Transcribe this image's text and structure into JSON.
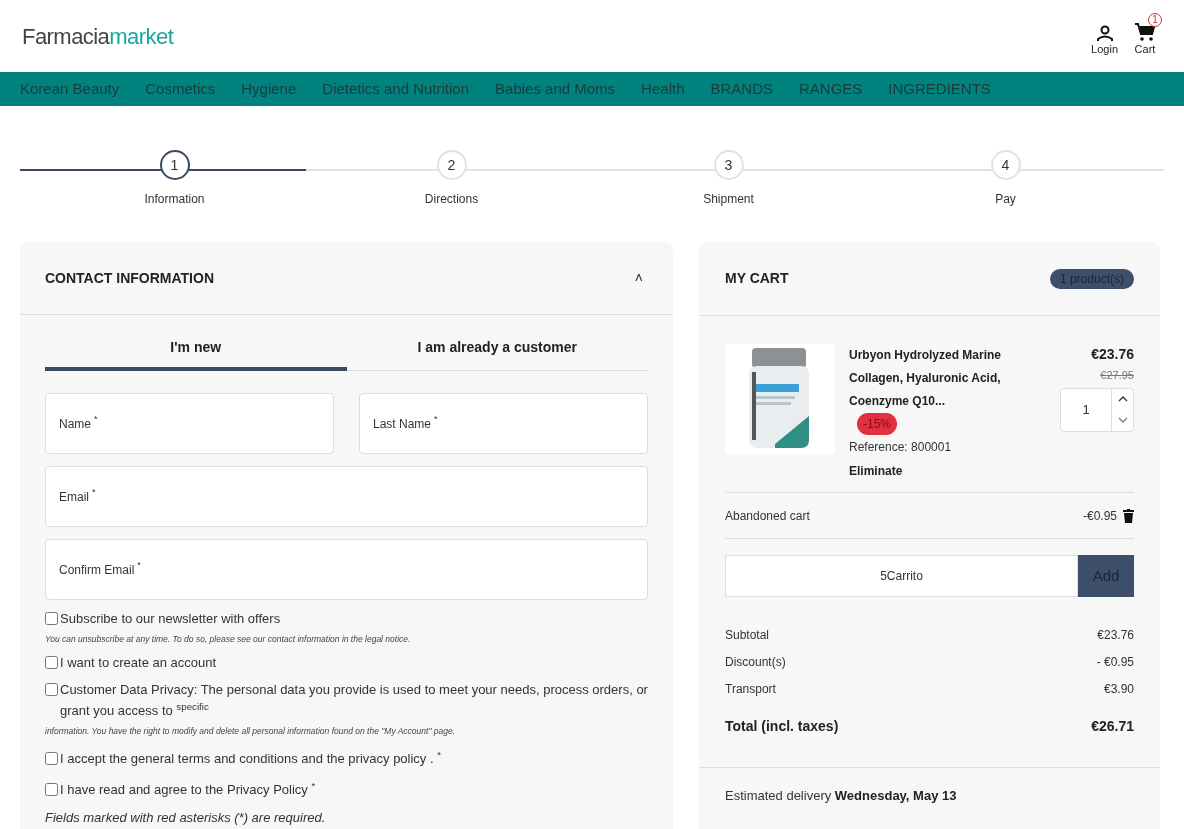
{
  "header": {
    "logo_dark": "Farmacia",
    "logo_light": "market",
    "login": "Login",
    "cart": "Cart",
    "cart_count": "1"
  },
  "nav": [
    "Korean Beauty",
    "Cosmetics",
    "Hygiene",
    "Dietetics and Nutrition",
    "Babies and Moms",
    "Health",
    "BRANDS",
    "RANGES",
    "INGREDIENTS"
  ],
  "steps": [
    {
      "number": "1",
      "label": "Information",
      "selected": true
    },
    {
      "number": "2",
      "label": "Directions",
      "selected": false
    },
    {
      "number": "3",
      "label": "Shipment",
      "selected": false
    },
    {
      "number": "4",
      "label": "Pay",
      "selected": false
    }
  ],
  "contact": {
    "title": "CONTACT INFORMATION",
    "collapse_icon": "˄",
    "tabs": [
      {
        "label": "I'm new",
        "selected": true
      },
      {
        "label": "I am already a customer",
        "selected": false
      }
    ],
    "fields": [
      {
        "label": "Name",
        "mark": "*"
      },
      {
        "label": "Last Name",
        "mark": "*"
      },
      {
        "label": "Email",
        "mark": "*"
      },
      {
        "label": "Confirm Email",
        "mark": "*"
      }
    ],
    "checkboxes": [
      {
        "label": "Subscribe to our newsletter with offers",
        "checked": false,
        "note": "You can unsubscribe at any time. To do so, please see our contact information in the legal notice."
      },
      {
        "label": "I want to create an account",
        "checked": false
      },
      {
        "label": "Customer Data Privacy: The personal data you provide is used to meet your needs, process orders, or grant you access to $^{specific}$",
        "checked": false,
        "note": "information. You have the right to modify and delete all personal information found on the \"My Account\" page."
      },
      {
        "label": "I accept the general terms and conditions and the privacy policy . $^{*}$",
        "checked": false
      },
      {
        "label": "I have read and agree to the  Privacy Policy $^{*}$",
        "checked": false
      }
    ],
    "footnote": "Fields marked with red asterisks (*) are required."
  },
  "cart": {
    "title": "MY CART",
    "count": "1 product(s)",
    "item": {
      "name": "Urbyon Hydrolyzed Marine Collagen, Hyaluronic Acid, Coenzyme Q10...",
      "discount": "-15%",
      "reference": "Reference: 800001",
      "remove": "Eliminate",
      "price": "€23.76",
      "old_price": "€27.95",
      "quantity": "1"
    },
    "voucher": {
      "label": "Abandoned cart",
      "amount": "-€0.95"
    },
    "code": {
      "value": "5Carrito",
      "button": "Add"
    },
    "summary": [
      {
        "label": "Subtotal",
        "value": "€23.76"
      },
      {
        "label": "Discount(s)",
        "value": "- €0.95"
      },
      {
        "label": "Transport",
        "value": "€3.90"
      }
    ],
    "total": {
      "label": "Total (incl. taxes)",
      "value": "€26.71"
    },
    "delivery": {
      "label": "Estimated delivery",
      "date": "Wednesday, May 13"
    }
  }
}
